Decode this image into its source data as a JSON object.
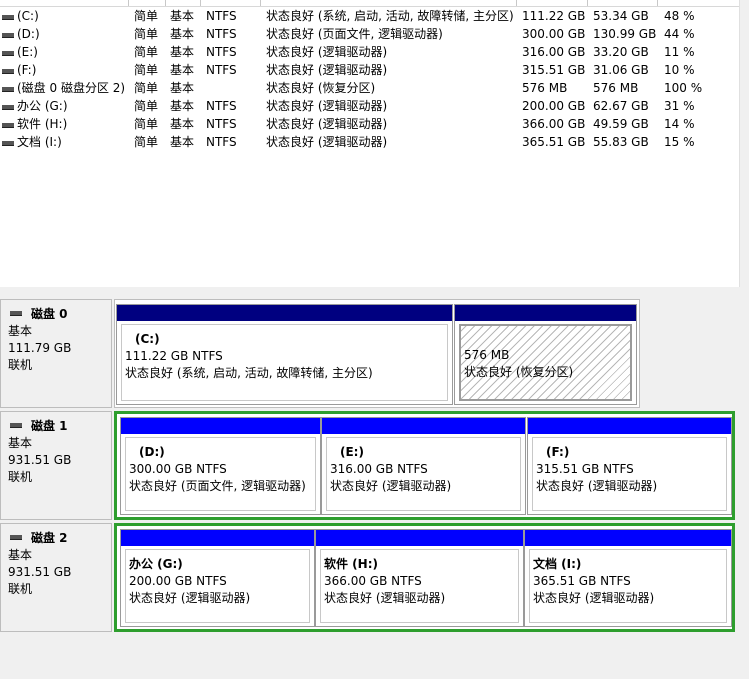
{
  "volumes": [
    {
      "name": "(C:)",
      "layout": "简单",
      "type": "基本",
      "fs": "NTFS",
      "status": "状态良好 (系统, 启动, 活动, 故障转储, 主分区)",
      "capacity": "111.22 GB",
      "free": "53.34 GB",
      "pct": "48 %"
    },
    {
      "name": "(D:)",
      "layout": "简单",
      "type": "基本",
      "fs": "NTFS",
      "status": "状态良好 (页面文件, 逻辑驱动器)",
      "capacity": "300.00 GB",
      "free": "130.99 GB",
      "pct": "44 %"
    },
    {
      "name": "(E:)",
      "layout": "简单",
      "type": "基本",
      "fs": "NTFS",
      "status": "状态良好 (逻辑驱动器)",
      "capacity": "316.00 GB",
      "free": "33.20 GB",
      "pct": "11 %"
    },
    {
      "name": "(F:)",
      "layout": "简单",
      "type": "基本",
      "fs": "NTFS",
      "status": "状态良好 (逻辑驱动器)",
      "capacity": "315.51 GB",
      "free": "31.06 GB",
      "pct": "10 %"
    },
    {
      "name": "(磁盘 0 磁盘分区 2)",
      "layout": "简单",
      "type": "基本",
      "fs": "",
      "status": "状态良好 (恢复分区)",
      "capacity": "576 MB",
      "free": "576 MB",
      "pct": "100 %"
    },
    {
      "name": "办公 (G:)",
      "layout": "简单",
      "type": "基本",
      "fs": "NTFS",
      "status": "状态良好 (逻辑驱动器)",
      "capacity": "200.00 GB",
      "free": "62.67 GB",
      "pct": "31 %"
    },
    {
      "name": "软件 (H:)",
      "layout": "简单",
      "type": "基本",
      "fs": "NTFS",
      "status": "状态良好 (逻辑驱动器)",
      "capacity": "366.00 GB",
      "free": "49.59 GB",
      "pct": "14 %"
    },
    {
      "name": "文档 (I:)",
      "layout": "简单",
      "type": "基本",
      "fs": "NTFS",
      "status": "状态良好 (逻辑驱动器)",
      "capacity": "365.51 GB",
      "free": "55.83 GB",
      "pct": "15 %"
    }
  ],
  "disks": [
    {
      "title": "磁盘 0",
      "type": "基本",
      "size": "111.79 GB",
      "state": "联机",
      "partitions": [
        {
          "name": "(C:)",
          "size": "111.22 GB NTFS",
          "status": "状态良好 (系统, 启动, 活动, 故障转储, 主分区)"
        },
        {
          "name": "",
          "size": "576 MB",
          "status": "状态良好 (恢复分区)"
        }
      ]
    },
    {
      "title": "磁盘 1",
      "type": "基本",
      "size": "931.51 GB",
      "state": "联机",
      "partitions": [
        {
          "name": "(D:)",
          "size": "300.00 GB NTFS",
          "status": "状态良好 (页面文件, 逻辑驱动器)"
        },
        {
          "name": "(E:)",
          "size": "316.00 GB NTFS",
          "status": "状态良好 (逻辑驱动器)"
        },
        {
          "name": "(F:)",
          "size": "315.51 GB NTFS",
          "status": "状态良好 (逻辑驱动器)"
        }
      ]
    },
    {
      "title": "磁盘 2",
      "type": "基本",
      "size": "931.51 GB",
      "state": "联机",
      "partitions": [
        {
          "name": "办公 (G:)",
          "size": "200.00 GB NTFS",
          "status": "状态良好 (逻辑驱动器)"
        },
        {
          "name": "软件 (H:)",
          "size": "366.00 GB NTFS",
          "status": "状态良好 (逻辑驱动器)"
        },
        {
          "name": "文档 (I:)",
          "size": "365.51 GB NTFS",
          "status": "状态良好 (逻辑驱动器)"
        }
      ]
    }
  ],
  "colors": {
    "primary_bar": "#000080",
    "logical_bar": "#0000ff",
    "extended_border": "#2e9e2e",
    "hatch": "#b8b8b8"
  }
}
